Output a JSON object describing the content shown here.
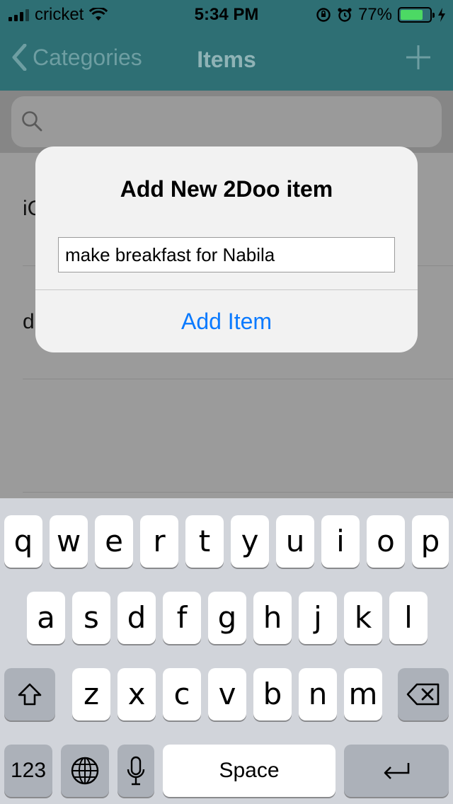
{
  "status": {
    "carrier": "cricket",
    "time": "5:34 PM",
    "battery": "77%"
  },
  "nav": {
    "back_label": "Categories",
    "title": "Items"
  },
  "search": {
    "placeholder": ""
  },
  "list": {
    "rows": [
      "iC",
      "d"
    ]
  },
  "alert": {
    "title": "Add New 2Doo item",
    "input_value": "make breakfast for Nabila",
    "action": "Add Item"
  },
  "keyboard": {
    "row1": [
      "q",
      "w",
      "e",
      "r",
      "t",
      "y",
      "u",
      "i",
      "o",
      "p"
    ],
    "row2": [
      "a",
      "s",
      "d",
      "f",
      "g",
      "h",
      "j",
      "k",
      "l"
    ],
    "row3": [
      "z",
      "x",
      "c",
      "v",
      "b",
      "n",
      "m"
    ],
    "numbers": "123",
    "space": "Space"
  },
  "colors": {
    "nav_bg": "#2e6f74",
    "accent": "#0a7aff",
    "battery": "#4cd964"
  }
}
